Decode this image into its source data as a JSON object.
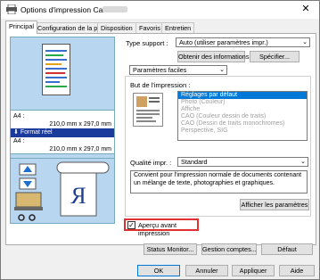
{
  "window": {
    "title": "Options d'impression Canon",
    "close_glyph": "✕",
    "app_icon": "printer-icon"
  },
  "tabs": [
    {
      "label": "Principal"
    },
    {
      "label": "Configuration de la page"
    },
    {
      "label": "Disposition"
    },
    {
      "label": "Favoris"
    },
    {
      "label": "Entretien"
    }
  ],
  "preview": {
    "size_row1": "A4 :",
    "size_row2": "210,0 mm x 297,0 mm",
    "selected": "Format réel",
    "size_row3": "A4 :",
    "size_row4": "210,0 mm x 297,0 mm",
    "orientation_glyph": "R",
    "counter_glyph": "ⵔⵔ"
  },
  "media": {
    "label": "Type support :",
    "value": "Auto (utiliser paramètres impr.)",
    "info_button": "Obtenir des informations...",
    "specify_button": "Spécifier..."
  },
  "settings_mode": {
    "value": "Paramètres faciles"
  },
  "print_purpose": {
    "label": "But de l'impression :",
    "items": [
      "Réglages par défaut",
      "Photo (Couleur)",
      "Affiche",
      "CAO (Couleur dessin de traits)",
      "CAO (Dessin de traits monochromes)",
      "Perspective, SIG"
    ],
    "selected_index": 0
  },
  "quality": {
    "label": "Qualité impr. :",
    "value": "Standard"
  },
  "description": "Convient pour l'impression normale de documents contenant un mélange de texte, photographies et graphiques.",
  "show_settings_button": "Afficher les paramètres",
  "preview_check": {
    "label": "Aperçu avant impression",
    "checked": true,
    "check_glyph": "✓"
  },
  "bottom_buttons": {
    "status": "Status Monitor...",
    "manage": "Gestion comptes...",
    "default": "Défaut"
  },
  "dialog_buttons": {
    "ok": "OK",
    "cancel": "Annuler",
    "apply": "Appliquer",
    "help": "Aide"
  }
}
